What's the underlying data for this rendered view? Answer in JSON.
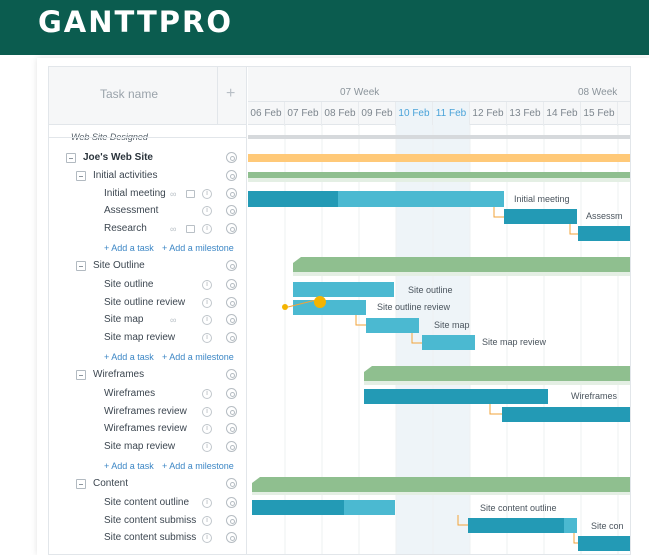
{
  "brand": {
    "logo_text": "GANTTPRO",
    "header_color": "#0b5c4f"
  },
  "grid_header": {
    "task_name_title": "Task name",
    "add_column_symbol": "+",
    "weeks": [
      "07 Week",
      "08 Week"
    ],
    "days": [
      "06 Feb",
      "07 Feb",
      "08 Feb",
      "09 Feb",
      "10 Feb",
      "11 Feb",
      "12 Feb",
      "13 Feb",
      "14 Feb",
      "15 Feb"
    ],
    "highlighted_days": [
      "10 Feb",
      "11 Feb"
    ]
  },
  "tasks": [
    {
      "type": "project",
      "label": "Web Site Designed",
      "style": "italic"
    },
    {
      "type": "group",
      "label": "Joe's Web Site",
      "style": "bold",
      "collapse": true,
      "settings": true
    },
    {
      "type": "group",
      "label": "Initial activities",
      "collapse": true,
      "settings": true
    },
    {
      "type": "task",
      "label": "Initial meeting",
      "link_icon": true,
      "comment_icon": true,
      "info": true,
      "settings": true
    },
    {
      "type": "task",
      "label": "Assessment",
      "info": true,
      "settings": true
    },
    {
      "type": "task",
      "label": "Research",
      "link_icon": true,
      "comment_icon": true,
      "info": true,
      "settings": true
    },
    {
      "type": "add",
      "add_task": "+ Add a task",
      "add_milestone": "+ Add a milestone"
    },
    {
      "type": "group",
      "label": "Site Outline",
      "collapse": true,
      "settings": true
    },
    {
      "type": "task",
      "label": "Site outline",
      "info": true,
      "settings": true
    },
    {
      "type": "task",
      "label": "Site outline review",
      "info": true,
      "settings": true
    },
    {
      "type": "task",
      "label": "Site map",
      "link_icon": true,
      "info": true,
      "settings": true
    },
    {
      "type": "task",
      "label": "Site map review",
      "info": true,
      "settings": true
    },
    {
      "type": "add",
      "add_task": "+ Add a task",
      "add_milestone": "+ Add a milestone"
    },
    {
      "type": "group",
      "label": "Wireframes",
      "collapse": true,
      "settings": true
    },
    {
      "type": "task",
      "label": "Wireframes",
      "info": true,
      "settings": true
    },
    {
      "type": "task",
      "label": "Wireframes review",
      "info": true,
      "settings": true
    },
    {
      "type": "task",
      "label": "Wireframes review",
      "info": true,
      "settings": true
    },
    {
      "type": "task",
      "label": "Site map review",
      "info": true,
      "settings": true
    },
    {
      "type": "add",
      "add_task": "+ Add a task",
      "add_milestone": "+ Add a milestone"
    },
    {
      "type": "group",
      "label": "Content",
      "collapse": true,
      "settings": true
    },
    {
      "type": "task",
      "label": "Site content outline",
      "info": true,
      "settings": true
    },
    {
      "type": "task",
      "label": "Site content submiss",
      "info": true,
      "settings": true
    },
    {
      "type": "task",
      "label": "Site content submiss",
      "info": true,
      "settings": true
    }
  ],
  "bar_labels": {
    "initial_meeting": "Initial meeting",
    "assessment": "Assessm",
    "site_outline": "Site outline",
    "site_outline_review": "Site outline review",
    "site_map": "Site map",
    "site_map_review": "Site map review",
    "wireframes": "Wireframes",
    "site_content_outline": "Site content outline",
    "site_content_submission": "Site con"
  },
  "colors": {
    "task_bar": "#239ab5",
    "task_bar_light": "#4bb9d1",
    "summary_bar": "#8fbf8f",
    "project_bar": "#ffc978",
    "project_summary": "#d6d9dc",
    "connector": "#f2a33a",
    "milestone": "#f4b400",
    "today_column": "#eef4f8"
  }
}
